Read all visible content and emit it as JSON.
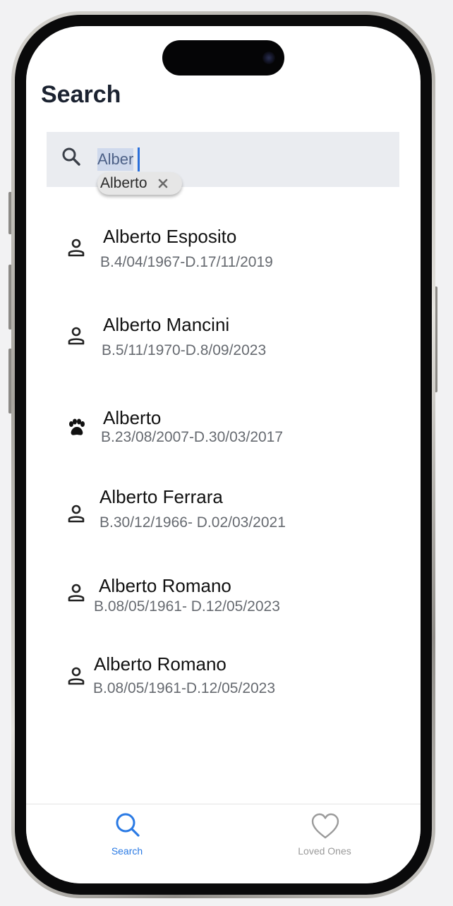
{
  "screen": {
    "title": "Search"
  },
  "search": {
    "query": "Alber",
    "suggestion": "Alberto"
  },
  "results": [
    {
      "name": "Alberto Esposito",
      "dates": "B.4/04/1967-D.17/11/2019",
      "icon": "person-icon"
    },
    {
      "name": "Alberto Mancini",
      "dates": "B.5/11/1970-D.8/09/2023",
      "icon": "person-icon"
    },
    {
      "name": "Alberto",
      "dates": "B.23/08/2007-D.30/03/2017",
      "icon": "paw-icon"
    },
    {
      "name": "Alberto Ferrara",
      "dates": "B.30/12/1966- D.02/03/2021",
      "icon": "person-icon"
    },
    {
      "name": "Alberto Romano",
      "dates": "B.08/05/1961- D.12/05/2023",
      "icon": "person-icon"
    },
    {
      "name": "Alberto Romano",
      "dates": "B.08/05/1961-D.12/05/2023",
      "icon": "person-icon"
    }
  ],
  "tabs": [
    {
      "label": "Search",
      "icon": "search-icon",
      "active": true
    },
    {
      "label": "Loved Ones",
      "icon": "heart-icon",
      "active": false
    }
  ],
  "colors": {
    "accent": "#2a7ae4",
    "inactive": "#9a9a9a",
    "search_bg": "#eaecf0"
  }
}
